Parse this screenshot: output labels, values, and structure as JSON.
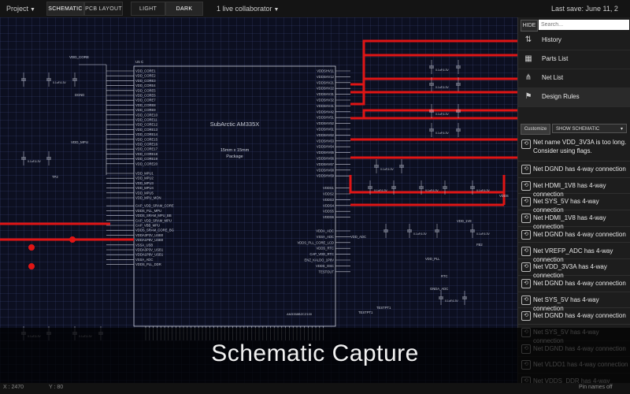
{
  "toolbar": {
    "project_label": "Project",
    "schematic_label": "SCHEMATIC",
    "pcb_layout_label": "PCB LAYOUT",
    "light_label": "LIGHT",
    "dark_label": "DARK",
    "collaborator_label": "1 live collaborator",
    "last_save": "Last save: June 11, 2"
  },
  "panel": {
    "hide_label": "HIDE",
    "search_placeholder": "Search...",
    "nav": [
      {
        "label": "History",
        "icon": "history-icon"
      },
      {
        "label": "Parts List",
        "icon": "parts-list-icon"
      },
      {
        "label": "Net List",
        "icon": "net-list-icon"
      },
      {
        "label": "Design Rules",
        "icon": "design-rules-icon"
      }
    ],
    "customize_label": "Customize",
    "show_select": "SHOW SCHEMATIC",
    "messages": [
      "Net name VDD_3V3A is too long. Consider using flags.",
      "Net DGND has 4-way connection",
      "Net HDMI_1V8 has 4-way connection",
      "Net SYS_5V has 4-way connection",
      "Net HDMI_1V8 has 4-way connection",
      "Net DGND has 4-way connection",
      "Net VREFP_ADC has 4-way connection",
      "Net VDD_3V3A has 4-way connection",
      "Net DGND has 4-way connection",
      "Net SYS_5V has 4-way connection",
      "Net DGND has 4-way connection",
      "Net SYS_5V has 4-way connection",
      "Net DGND has 4-way connection",
      "Net VLDO1 has 4-way connection",
      "Net VDDS_DDR has 4-way connection"
    ]
  },
  "schematic": {
    "chip_title": "SubArctic AM335X",
    "package_line1": "15mm x 15mm",
    "package_line2": "Package",
    "ref": "U5 C",
    "part_number": "AM3358BZCZ100",
    "vdd_core": "VDD_CORE",
    "vdd_mpu": "VDD_MPU",
    "left_pins": [
      "VDD_CORE1",
      "VDD_CORE2",
      "VDD_CORE3",
      "VDD_CORE4",
      "VDD_CORE5",
      "VDD_CORE6",
      "VDD_CORE7",
      "VDD_CORE8",
      "VDD_CORE9",
      "VDD_CORE10",
      "VDD_CORE11",
      "VDD_CORE12",
      "VDD_CORE13",
      "VDD_CORE14",
      "VDD_CORE15",
      "VDD_CORE16",
      "VDD_CORE17",
      "VDD_CORE18",
      "VDD_CORE19",
      "VDD_CORE20",
      "VDD_MPU1",
      "VDD_MPU2",
      "VDD_MPU3",
      "VDD_MPU4",
      "VDD_MPU5",
      "VDD_MPU_MON",
      "CAP_VDD_SRAM_CORE",
      "VDDS_PLL_MPU",
      "VDDS_SRAM_MPU_BB",
      "CAP_VDD_SRAM_MPU",
      "CAP_VBB_MPU",
      "VDDS_SRAM_CORE_BG",
      "VDDA3P3V_USB0",
      "VDDA1P8V_USB0",
      "VSSA_USB",
      "VDDA3P3V_USB1",
      "VDDA1P8V_USB1",
      "VSSA_ADC",
      "VDDS_PLL_DDR"
    ],
    "right_pins": [
      "VDDSHV11",
      "VDDSHV12",
      "VDDSHV21",
      "VDDSHV22",
      "VDDSHV31",
      "VDDSHV32",
      "VDDSHV41",
      "VDDSHV42",
      "VDDSHV51",
      "VDDSHV52",
      "VDDSHV61",
      "VDDSHV62",
      "VDDSHV63",
      "VDDSHV64",
      "VDDSHV65",
      "VDDSHV66",
      "VDDSHV67",
      "VDDSHV68",
      "VDDSHV69",
      "VDDS1",
      "VDDS2",
      "VDDS3",
      "VDDS4",
      "VDDS5",
      "VDDS6",
      "VDDA_ADC",
      "VSSA_ADC",
      "VDDS_PLL_CORE_LCD",
      "VDDS_RTC",
      "CAP_VDD_RTC",
      "ENZ_KALDO_1P8V",
      "VDDS_OSC",
      "TESTOUT"
    ],
    "cap_value": "0.1uF,6.3V",
    "labels": [
      "DGND",
      "VDD_1V8",
      "VDD_ADC",
      "VDD_PLL",
      "RTC",
      "GNDA_ADC",
      "TESTPT1",
      "VDDS",
      "FB2",
      "TP2",
      "TESTPT1"
    ]
  },
  "caption": "Schematic Capture",
  "status": {
    "coord_x": "X : 2470",
    "coord_y": "Y : 80",
    "pin_names": "Pin names off"
  },
  "colors": {
    "net_highlight": "#e01515",
    "wire": "#c8ccd8",
    "canvas_bg": "#0c0f20"
  }
}
